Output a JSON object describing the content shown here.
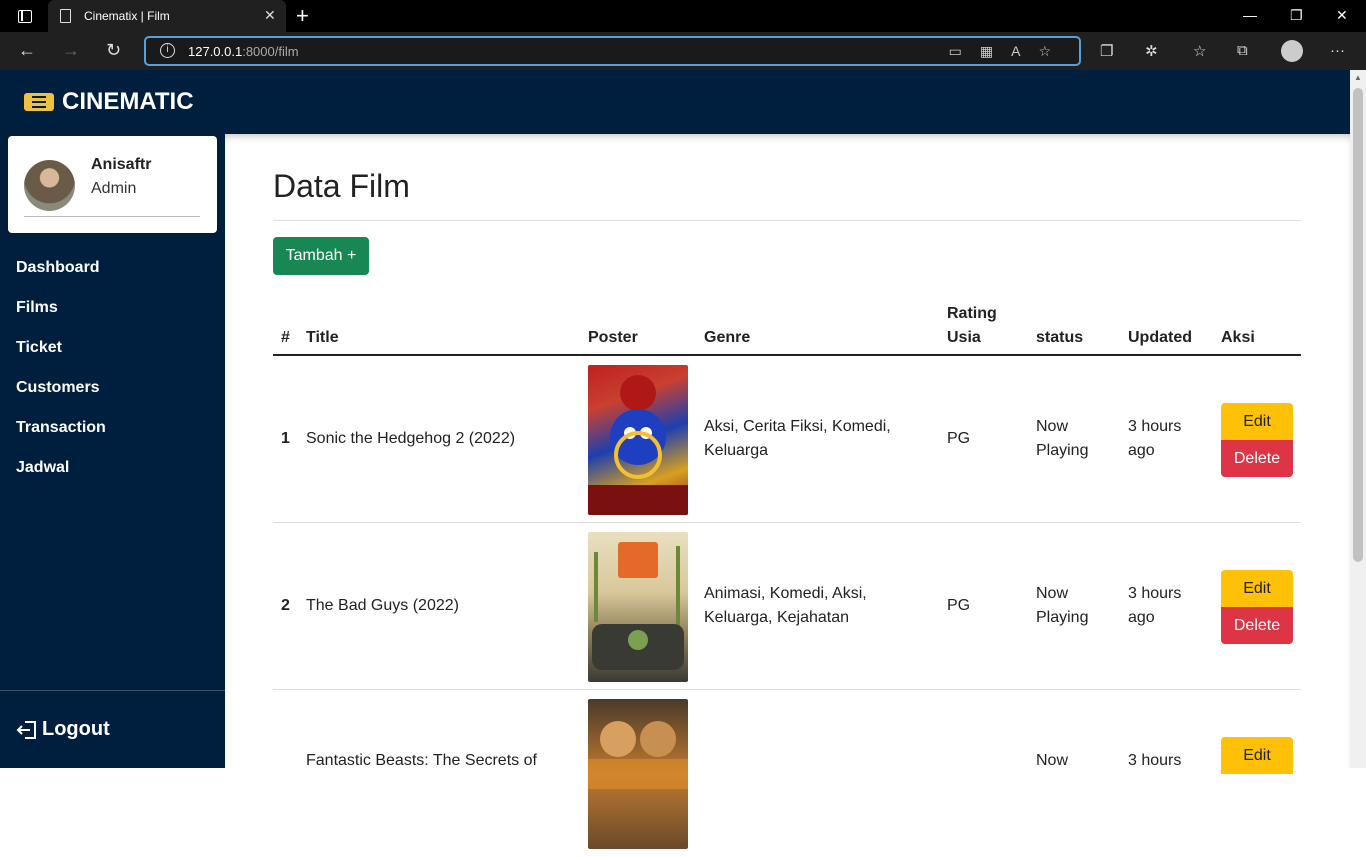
{
  "browser": {
    "tab_title": "Cinematix | Film",
    "url_host": "127.0.0.1",
    "url_path": ":8000/film"
  },
  "app": {
    "brand": "CINEMATIC",
    "user": {
      "name": "Anisaftr",
      "role": "Admin"
    },
    "menu": [
      "Dashboard",
      "Films",
      "Ticket",
      "Customers",
      "Transaction",
      "Jadwal"
    ],
    "logout": "Logout"
  },
  "main": {
    "title": "Data Film",
    "add_button": "Tambah +",
    "columns": {
      "num": "#",
      "title": "Title",
      "poster": "Poster",
      "genre": "Genre",
      "rating_1": "Rating",
      "rating_2": "Usia",
      "status": "status",
      "updated": "Updated",
      "aksi": "Aksi"
    },
    "rows": [
      {
        "num": "1",
        "title": "Sonic the Hedgehog 2 (2022)",
        "genre_1": "Aksi, Cerita Fiksi, Komedi,",
        "genre_2": "Keluarga",
        "rating": "PG",
        "status_1": "Now",
        "status_2": "Playing",
        "updated_1": "3 hours",
        "updated_2": "ago",
        "edit": "Edit",
        "delete": "Delete"
      },
      {
        "num": "2",
        "title": "The Bad Guys (2022)",
        "genre_1": "Animasi, Komedi, Aksi,",
        "genre_2": "Keluarga, Kejahatan",
        "rating": "PG",
        "status_1": "Now",
        "status_2": "Playing",
        "updated_1": "3 hours",
        "updated_2": "ago",
        "edit": "Edit",
        "delete": "Delete"
      },
      {
        "num": "",
        "title": "Fantastic Beasts: The Secrets of",
        "genre_1": "",
        "genre_2": "",
        "rating": "",
        "status_1": "Now",
        "status_2": "",
        "updated_1": "3 hours",
        "updated_2": "",
        "edit": "Edit",
        "delete": ""
      }
    ]
  },
  "colors": {
    "navy": "#001f3f",
    "add_green": "#198754",
    "edit_yellow": "#ffc107",
    "delete_red": "#dc3545"
  }
}
